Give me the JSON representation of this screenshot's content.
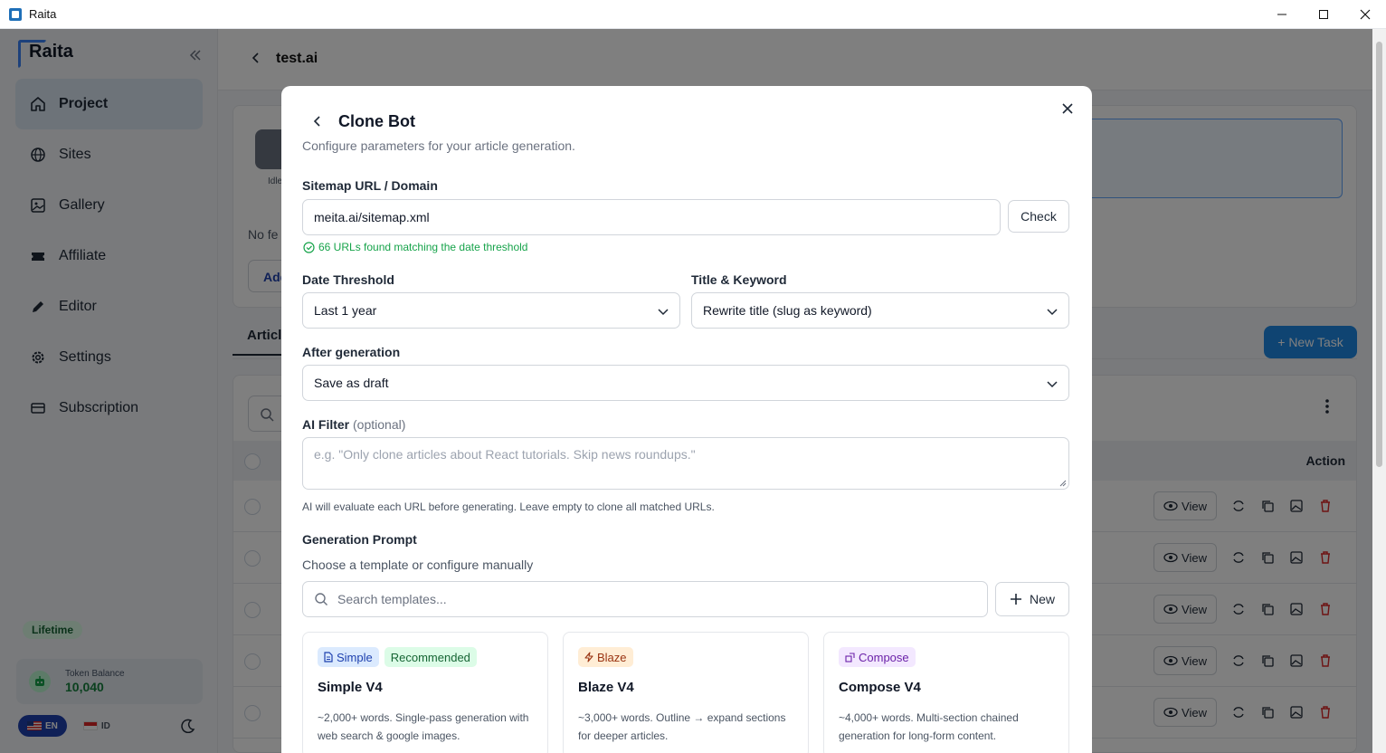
{
  "window": {
    "title": "Raita"
  },
  "sidebar": {
    "logo": "Raita",
    "items": [
      {
        "label": "Project",
        "icon": "home-icon"
      },
      {
        "label": "Sites",
        "icon": "globe-icon"
      },
      {
        "label": "Gallery",
        "icon": "image-icon"
      },
      {
        "label": "Affiliate",
        "icon": "ticket-icon"
      },
      {
        "label": "Editor",
        "icon": "pencil-icon"
      },
      {
        "label": "Settings",
        "icon": "gear-icon"
      },
      {
        "label": "Subscription",
        "icon": "card-icon"
      }
    ],
    "plan_badge": "Lifetime",
    "token": {
      "label": "Token Balance",
      "value": "10,040"
    },
    "languages": [
      {
        "code": "EN"
      },
      {
        "code": "ID"
      }
    ]
  },
  "main": {
    "title": "test.ai",
    "idle_label": "Idle",
    "no_feed_text": "No fe",
    "add_btn_text": "Add",
    "tab_label": "Article",
    "new_task_label": "+ New Task",
    "action_header": "Action",
    "view_label": "View"
  },
  "modal": {
    "title": "Clone Bot",
    "subtitle": "Configure parameters for your article generation.",
    "sitemap": {
      "label": "Sitemap URL / Domain",
      "value": "meita.ai/sitemap.xml",
      "check_label": "Check",
      "success": "66 URLs found matching the date threshold"
    },
    "date_threshold": {
      "label": "Date Threshold",
      "value": "Last 1 year"
    },
    "title_keyword": {
      "label": "Title & Keyword",
      "value": "Rewrite title (slug as keyword)"
    },
    "after_generation": {
      "label": "After generation",
      "value": "Save as draft"
    },
    "ai_filter": {
      "label": "AI Filter",
      "optional": "(optional)",
      "placeholder": "e.g. \"Only clone articles about React tutorials. Skip news roundups.\"",
      "help": "AI will evaluate each URL before generating. Leave empty to clone all matched URLs."
    },
    "generation_prompt": {
      "label": "Generation Prompt",
      "subtitle": "Choose a template or configure manually",
      "search_placeholder": "Search templates...",
      "new_label": "New"
    },
    "templates": [
      {
        "tag": "Simple",
        "extra_tag": "Recommended",
        "name": "Simple V4",
        "desc": "~2,000+ words. Single-pass generation with web search & google images."
      },
      {
        "tag": "Blaze",
        "name": "Blaze V4",
        "desc": "~3,000+ words. Outline → expand sections for deeper articles."
      },
      {
        "tag": "Compose",
        "name": "Compose V4",
        "desc": "~4,000+ words. Multi-section chained generation for long-form content."
      }
    ]
  },
  "colors": {
    "accent": "#1e88e5",
    "success": "#16a34a",
    "active_nav": "#dbe7f2"
  }
}
